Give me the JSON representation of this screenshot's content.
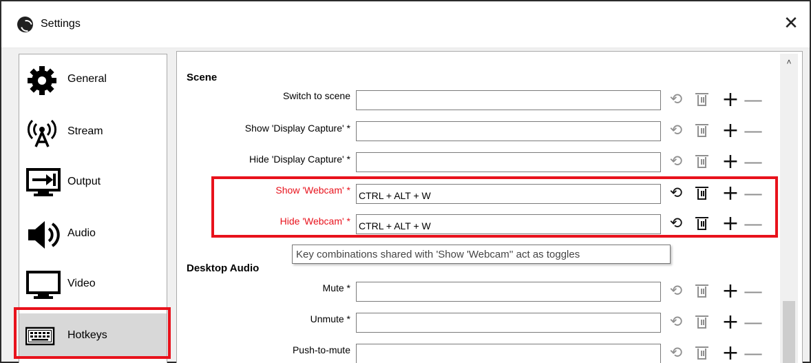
{
  "window": {
    "title": "Settings",
    "close_label": "✕"
  },
  "sidebar": {
    "items": [
      {
        "label": "General",
        "icon": "gear-icon"
      },
      {
        "label": "Stream",
        "icon": "antenna-icon"
      },
      {
        "label": "Output",
        "icon": "monitor-arrow-icon"
      },
      {
        "label": "Audio",
        "icon": "speaker-icon"
      },
      {
        "label": "Video",
        "icon": "monitor-icon"
      },
      {
        "label": "Hotkeys",
        "icon": "keyboard-icon",
        "selected": true
      }
    ]
  },
  "hotkeys": {
    "scene_section": "Scene",
    "desktop_audio_section": "Desktop Audio",
    "rows": [
      {
        "label": "Switch to scene",
        "value": "",
        "highlighted": false
      },
      {
        "label": "Show 'Display Capture' *",
        "value": "",
        "highlighted": false
      },
      {
        "label": "Hide 'Display Capture' *",
        "value": "",
        "highlighted": false
      },
      {
        "label": "Show 'Webcam' *",
        "value": "CTRL + ALT + W",
        "highlighted": true
      },
      {
        "label": "Hide 'Webcam' *",
        "value": "CTRL + ALT + W",
        "highlighted": true
      },
      {
        "label": "Mute *",
        "value": "",
        "highlighted": false
      },
      {
        "label": "Unmute *",
        "value": "",
        "highlighted": false
      },
      {
        "label": "Push-to-mute",
        "value": "",
        "highlighted": false
      }
    ],
    "tooltip": "Key combinations shared with 'Show 'Webcam'' act as toggles"
  },
  "colors": {
    "highlight": "#e8121c",
    "selected_bg": "#d8d8d8"
  }
}
